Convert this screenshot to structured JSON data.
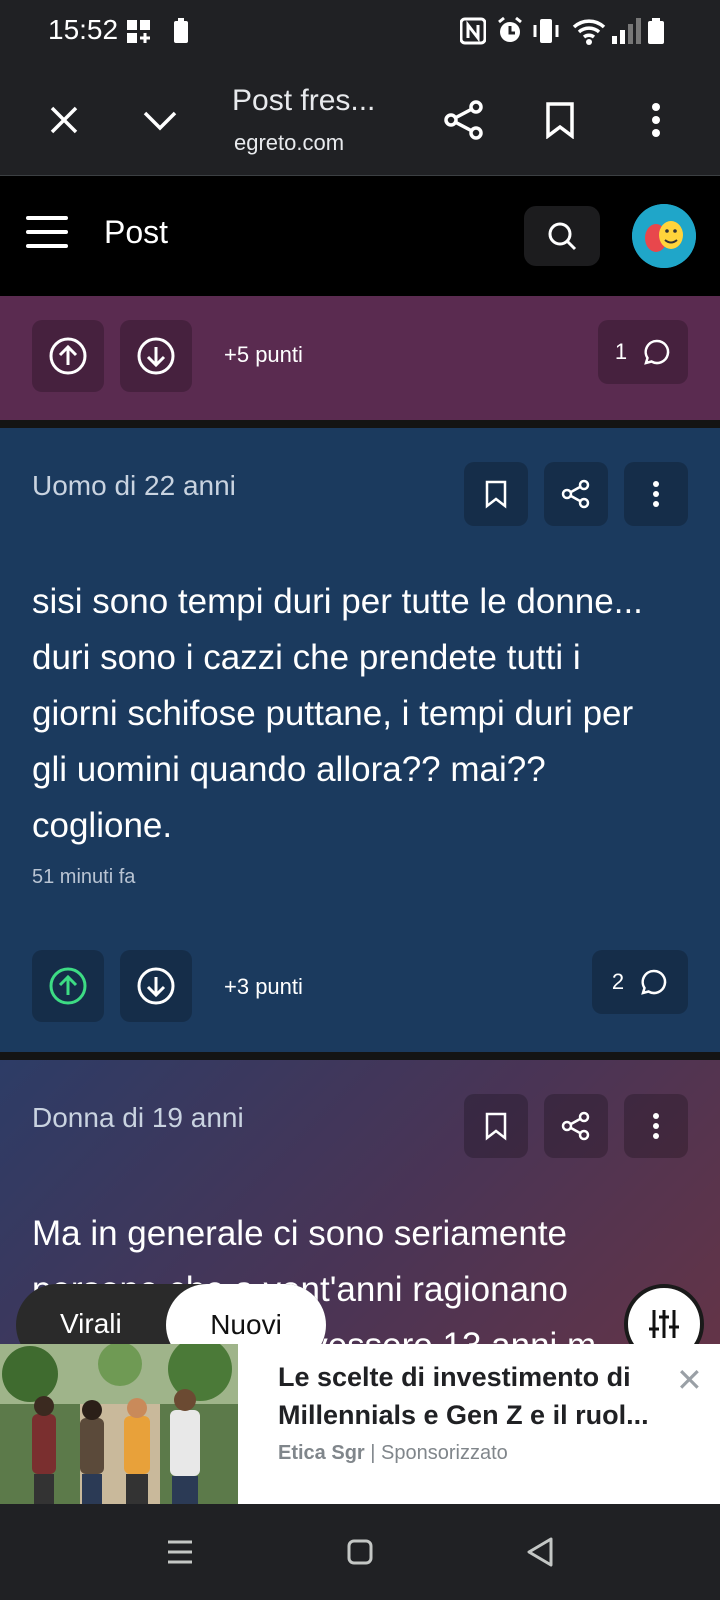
{
  "status_bar": {
    "time": "15:52"
  },
  "browser": {
    "title": "Post fres...",
    "url": "egreto.com"
  },
  "site": {
    "title": "Post"
  },
  "posts": [
    {
      "points": "+5 punti",
      "comments": "1",
      "upvoted": false
    },
    {
      "author": "Uomo di 22 anni",
      "text": "sisi sono tempi duri per tutte le donne... duri sono i cazzi che prendete tutti i giorni schifose puttane, i tempi duri per gli uomini quando allora?? mai?? coglione.",
      "time": "51 minuti fa",
      "points": "+3 punti",
      "comments": "2",
      "upvoted": true
    },
    {
      "author": "Donna di 19 anni",
      "text": "Ma in generale ci sono seriamente persone che a vent'anni ragionano ancora come se avessero 13 anni m..."
    }
  ],
  "tabs": {
    "virali": "Virali",
    "nuovi": "Nuovi",
    "active": "Nuovi"
  },
  "ad": {
    "title": "Le scelte di investimento di Millennials e Gen Z e il ruol...",
    "advertiser": "Etica Sgr",
    "label": "Sponsorizzato",
    "close": "✕"
  },
  "colors": {
    "post1_bg": "#5a2b50",
    "post2_bg": "#1b3a5e",
    "upvote_active": "#3ddc84"
  }
}
